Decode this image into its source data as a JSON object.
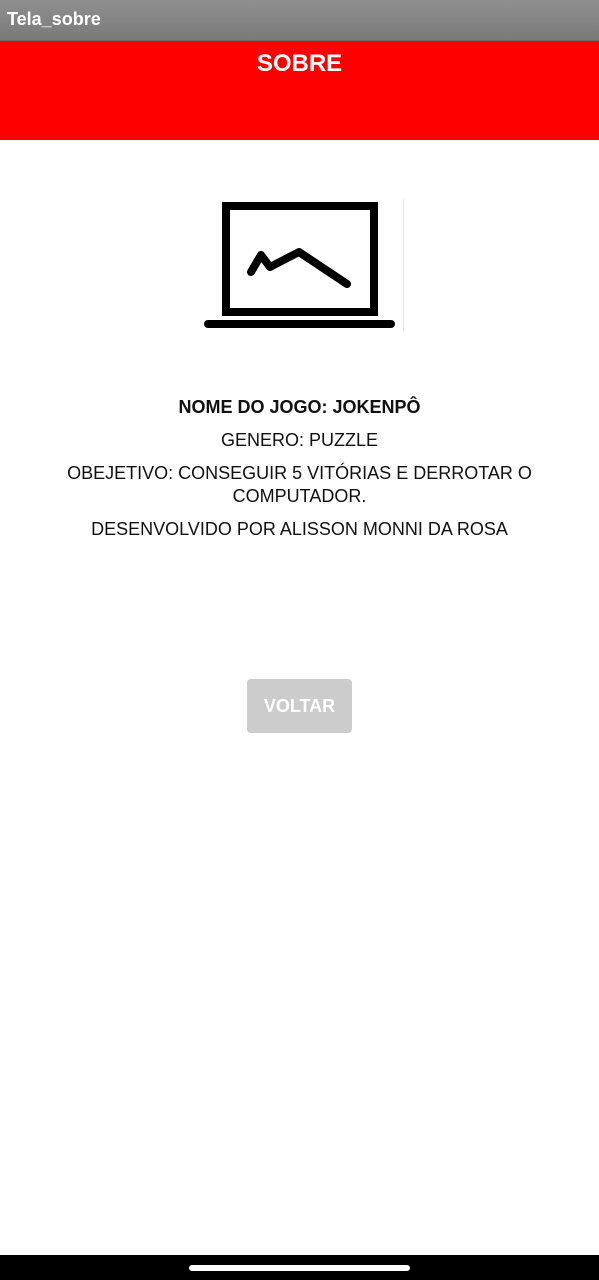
{
  "window": {
    "title": "Tela_sobre"
  },
  "header": {
    "title": "SOBRE",
    "background_color": "#ff0000"
  },
  "illustration": {
    "icon": "laptop-chart-icon"
  },
  "info": {
    "game_name": "NOME DO JOGO: JOKENPÔ",
    "genre": "GENERO: PUZZLE",
    "objective": "OBEJETIVO: CONSEGUIR 5 VITÓRIAS E DERROTAR O COMPUTADOR.",
    "developer": "DESENVOLVIDO POR ALISSON MONNI DA ROSA"
  },
  "actions": {
    "back_label": "VOLTAR",
    "back_color": "#cccccc"
  },
  "system_nav": {
    "home_indicator": "home-indicator"
  }
}
